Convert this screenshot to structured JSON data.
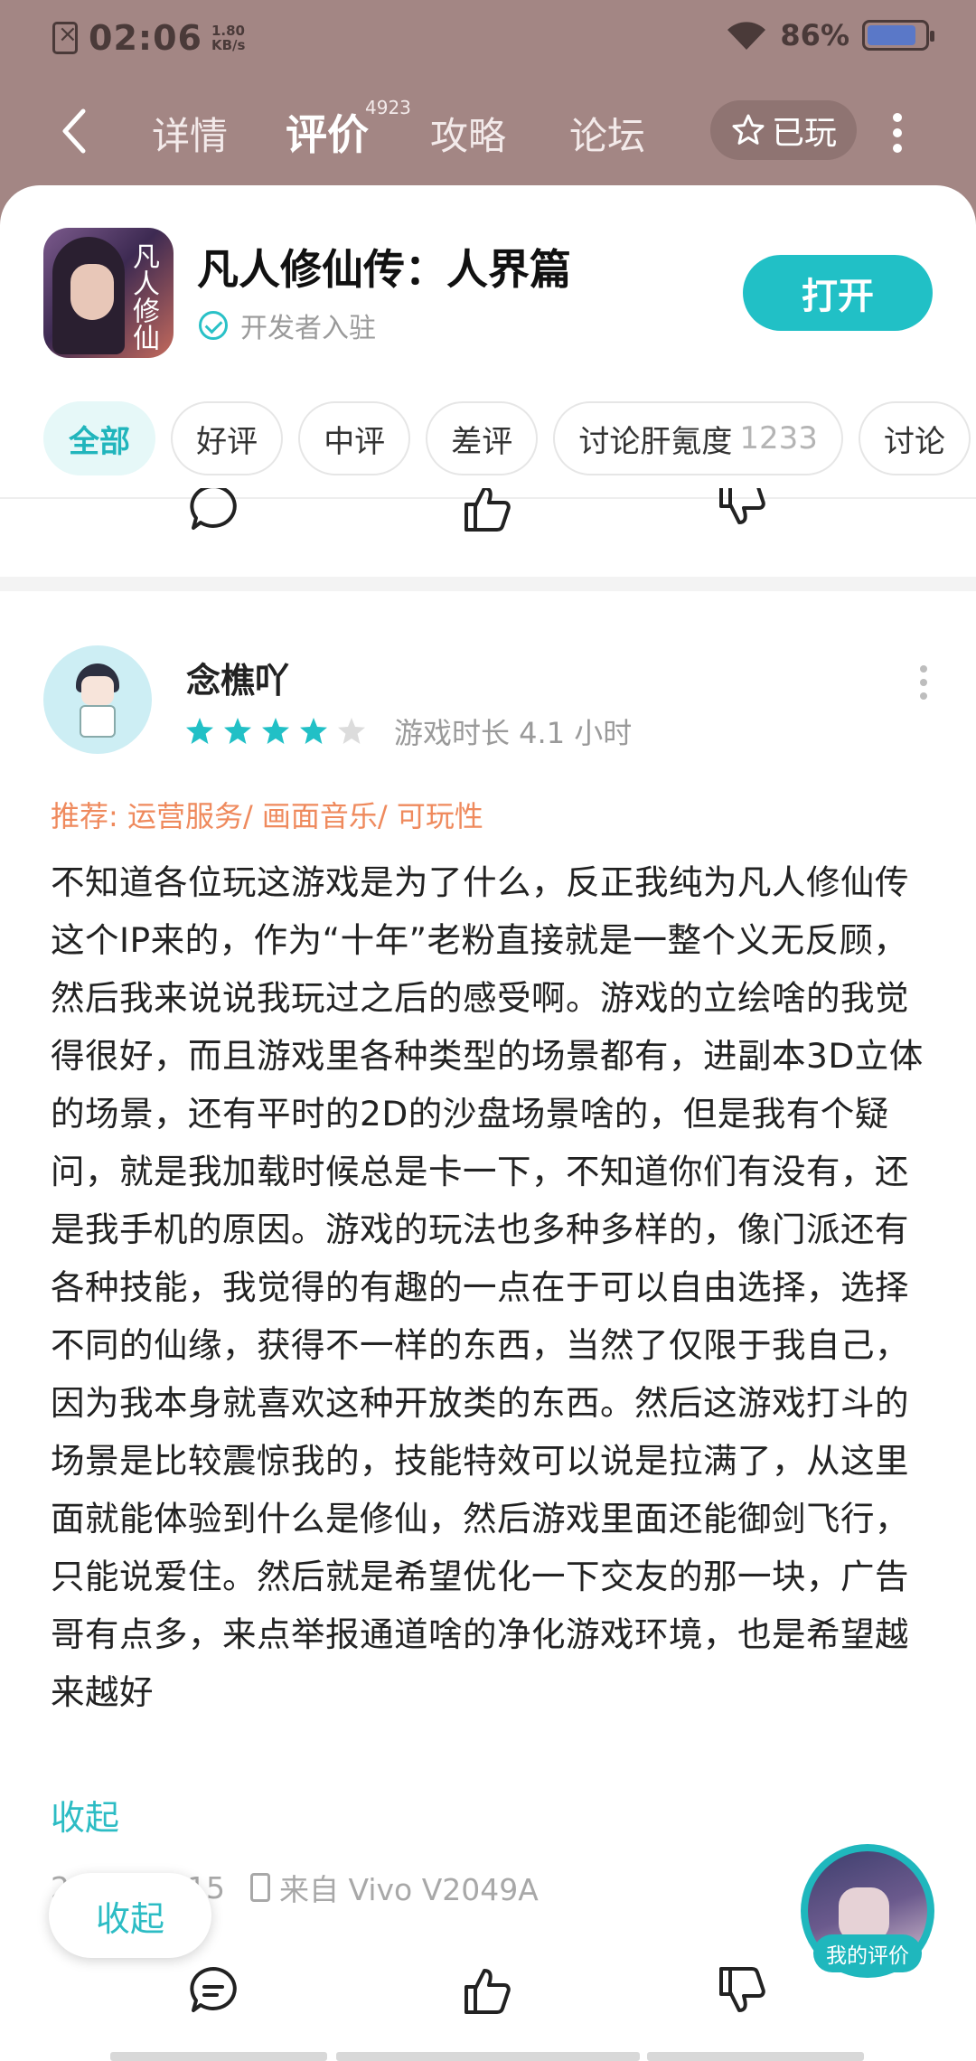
{
  "status_bar": {
    "time": "02:06",
    "speed_top": "1.80",
    "speed_bottom": "KB/s",
    "battery": "86%"
  },
  "nav": {
    "tabs": [
      {
        "label": "详情"
      },
      {
        "label": "评价",
        "badge": "4923"
      },
      {
        "label": "攻略"
      },
      {
        "label": "论坛"
      }
    ],
    "played_label": "已玩"
  },
  "app": {
    "title": "凡人修仙传：人界篇",
    "developer_badge": "开发者入驻",
    "open_label": "打开",
    "icon_calligraphy": "凡人修仙"
  },
  "filters": [
    {
      "label": "全部",
      "active": true
    },
    {
      "label": "好评"
    },
    {
      "label": "中评"
    },
    {
      "label": "差评"
    },
    {
      "label": "讨论肝氪度",
      "count": "1233"
    },
    {
      "label": "讨论"
    }
  ],
  "review": {
    "author": "念樵吖",
    "rating": 4,
    "rating_max": 5,
    "playtime": "游戏时长 4.1 小时",
    "recommend": "推荐: 运营服务/ 画面音乐/ 可玩性",
    "text": "不知道各位玩这游戏是为了什么，反正我纯为凡人修仙传这个IP来的，作为“十年”老粉直接就是一整个义无反顾，然后我来说说我玩过之后的感受啊。游戏的立绘啥的我觉得很好，而且游戏里各种类型的场景都有，进副本3D立体的场景，还有平时的2D的沙盘场景啥的，但是我有个疑问，就是我加载时候总是卡一下，不知道你们有没有，还是我手机的原因。游戏的玩法也多种多样的，像门派还有各种技能，我觉得的有趣的一点在于可以自由选择，选择不同的仙缘，获得不一样的东西，当然了仅限于我自己，因为我本身就喜欢这种开放类的东西。然后这游戏打斗的场景是比较震惊我的，技能特效可以说是拉满了，从这里面就能体验到什么是修仙，然后游戏里面还能御剑飞行，只能说爱住。然后就是希望优化一下交友的那一块，广告哥有点多，来点举报通道啥的净化游戏环境，也是希望越来越好",
    "collapse_label": "收起",
    "date_partial": "2",
    "date_partial_tail": "15",
    "device": "来自 Vivo V2049A"
  },
  "floating": {
    "collapse_label": "收起",
    "my_review_label": "我的评价"
  },
  "colors": {
    "header_bg": "#a38684",
    "accent": "#21c0c6",
    "recommend": "#ef8a5d",
    "star_on": "#21c0c6",
    "star_off": "#dcdcdc"
  },
  "icons": [
    "back-arrow-icon",
    "star-outline-icon",
    "more-vertical-icon",
    "verified-check-icon",
    "comment-icon",
    "thumbs-up-icon",
    "thumbs-down-icon",
    "phone-icon"
  ]
}
